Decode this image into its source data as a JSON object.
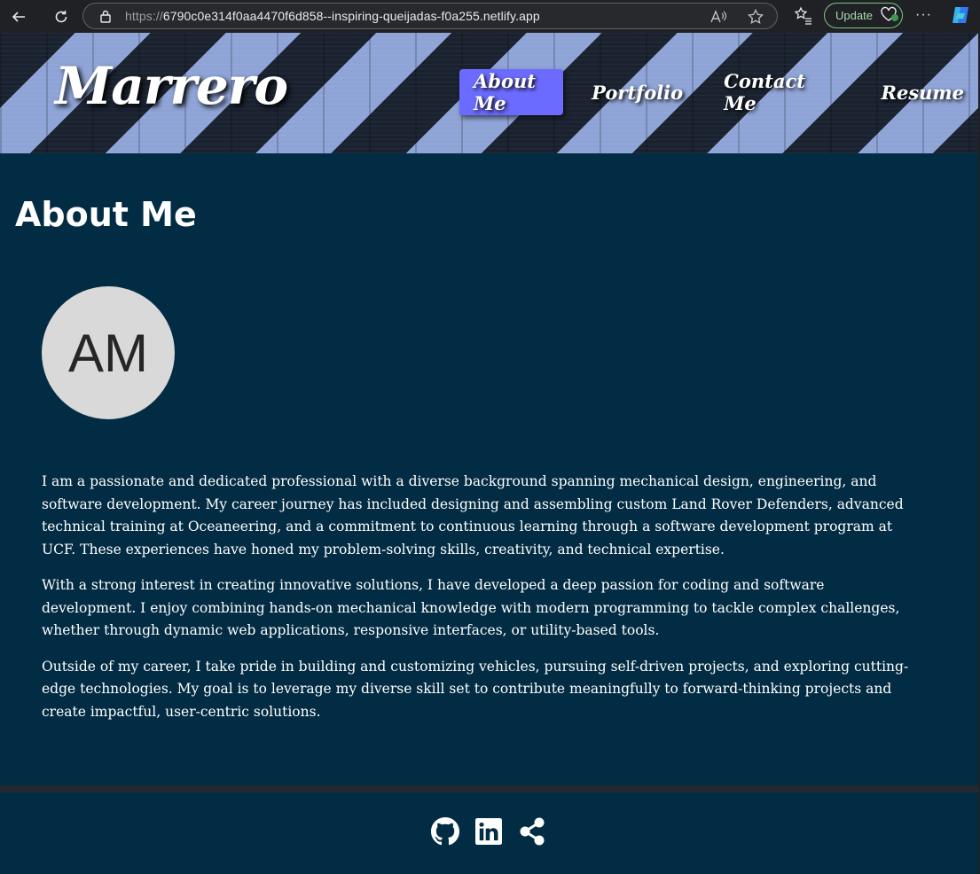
{
  "browser": {
    "url_scheme": "https://",
    "url_host": "6790c0e314f0aa4470f6d858--inspiring-queijadas-f0a255.netlify.app",
    "update_label": "Update",
    "more_label": "···"
  },
  "header": {
    "brand": "Marrero",
    "nav": [
      {
        "label": "About Me",
        "active": true
      },
      {
        "label": "Portfolio",
        "active": false
      },
      {
        "label": "Contact Me",
        "active": false
      },
      {
        "label": "Resume",
        "active": false
      }
    ],
    "accent_color": "#6b6bff"
  },
  "main": {
    "title": "About Me",
    "avatar_initials": "AM",
    "paragraphs": [
      "I am a passionate and dedicated professional with a diverse background spanning mechanical design, engineering, and software development. My career journey has included designing and assembling custom Land Rover Defenders, advanced technical training at Oceaneering, and a commitment to continuous learning through a software development program at UCF. These experiences have honed my problem-solving skills, creativity, and technical expertise.",
      "With a strong interest in creating innovative solutions, I have developed a deep passion for coding and software development. I enjoy combining hands-on mechanical knowledge with modern programming to tackle complex challenges, whether through dynamic web applications, responsive interfaces, or utility-based tools.",
      "Outside of my career, I take pride in building and customizing vehicles, pursuing self-driven projects, and exploring cutting-edge technologies. My goal is to leverage my diverse skill set to contribute meaningfully to forward-thinking projects and create impactful, user-centric solutions."
    ],
    "background_color": "#022c43"
  },
  "footer": {
    "icons": [
      "github-icon",
      "linkedin-icon",
      "share-icon"
    ]
  }
}
